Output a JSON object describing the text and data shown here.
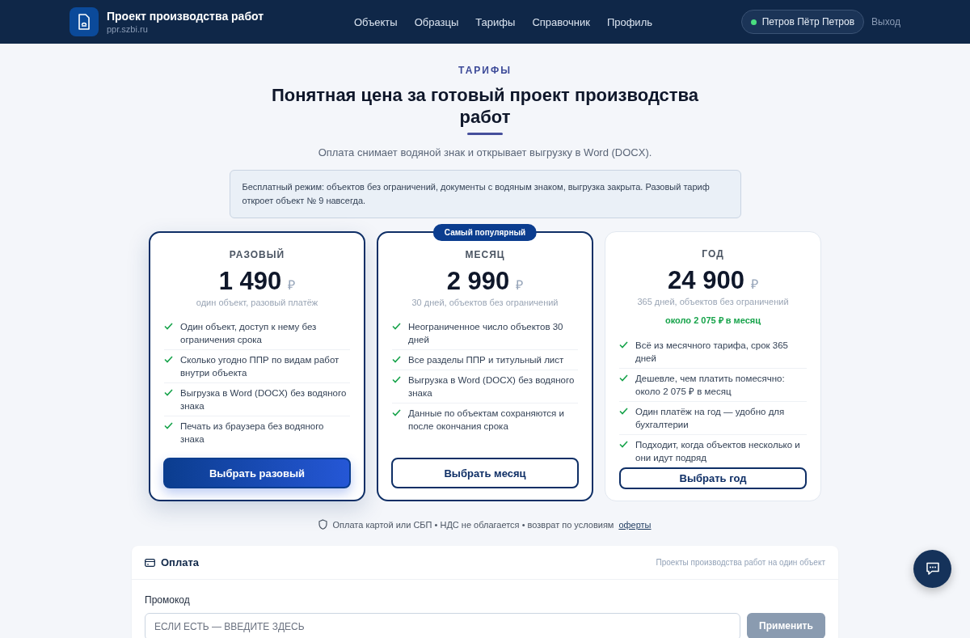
{
  "header": {
    "brand_title": "Проект производства работ",
    "brand_subtitle": "ppr.szbi.ru",
    "nav": [
      "Объекты",
      "Образцы",
      "Тарифы",
      "Справочник",
      "Профиль"
    ],
    "user": {
      "name": "Петров Пётр Петров",
      "online": true
    },
    "logout": "Выход"
  },
  "hero": {
    "eyebrow": "ТАРИФЫ",
    "title": "Понятная цена за готовый проект производства работ",
    "subtitle": "Оплата снимает водяной знак и открывает выгрузку в Word (DOCX).",
    "notice": "Бесплатный режим: объектов без ограничений, документы с водяным знаком, выгрузка закрыта. Разовый тариф откроет объект № 9 навсегда."
  },
  "plans": [
    {
      "name": "РАЗОВЫЙ",
      "price": "1 490",
      "currency": "₽",
      "period": "один объект, разовый платёж",
      "selected": true,
      "features": [
        "Один объект, доступ к нему без ограничения срока",
        "Сколько угодно ППР по видам работ внутри объекта",
        "Выгрузка в Word (DOCX) без водяного знака",
        "Печать из браузера без водяного знака"
      ],
      "button": "Выбрать разовый"
    },
    {
      "name": "МЕСЯЦ",
      "price": "2 990",
      "currency": "₽",
      "period": "30 дней, объектов без ограничений",
      "badge": "Самый популярный",
      "selected": false,
      "features": [
        "Неограниченное число объектов 30 дней",
        "Все разделы ППР и титульный лист",
        "Выгрузка в Word (DOCX) без водяного знака",
        "Данные по объектам сохраняются и после окончания срока"
      ],
      "button": "Выбрать месяц"
    },
    {
      "name": "ГОД",
      "price": "24 900",
      "currency": "₽",
      "period": "365 дней, объектов без ограничений",
      "savings": "около 2 075 ₽ в месяц",
      "selected": false,
      "features": [
        "Всё из месячного тарифа, срок 365 дней",
        "Дешевле, чем платить помесячно: около 2 075 ₽ в месяц",
        "Один платёж на год — удобно для бухгалтерии",
        "Подходит, когда объектов несколько и они идут подряд"
      ],
      "button": "Выбрать год"
    }
  ],
  "payment_note": {
    "text": "Оплата картой или СБП • НДС не облагается • возврат по условиям",
    "link": "оферты"
  },
  "payment": {
    "title": "Оплата",
    "caption": "Проекты производства работ на один объект",
    "promo_label": "Промокод",
    "promo_placeholder": "ЕСЛИ ЕСТЬ — ВВЕДИТЕ ЗДЕСЬ",
    "apply_button": "Применить"
  }
}
